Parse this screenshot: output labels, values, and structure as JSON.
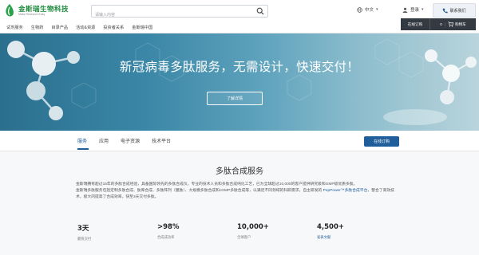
{
  "header": {
    "logo_title": "金斯瑞生物科技",
    "logo_subtitle": "Make Research Easy",
    "search_placeholder": "请输入内容",
    "language": "中文",
    "login": "登录",
    "contact": "联系我们"
  },
  "nav": {
    "items": [
      "试剂服务",
      "生物药",
      "目录产品",
      "活动&资源",
      "投资者关系",
      "金斯瑞中国"
    ],
    "order_online": "在线订购",
    "cart_label": "购物车",
    "cart_count": "0"
  },
  "hero": {
    "title": "新冠病毒多肽服务，无需设计，快速交付！",
    "button": "了解详情"
  },
  "subnav": {
    "tabs": [
      "服务",
      "应用",
      "电子资源",
      "技术平台"
    ],
    "active_tab": "服务",
    "order_button": "在线订购"
  },
  "content": {
    "section_title": "多肽合成服务",
    "para1": "金斯瑞拥有超过15年的多肽合成经验，具备国际领先的多肽合成仪，专业的技术人员和多肽合成纯化工艺，已为全球超过10,000的客户提供研究级和GMP级优质多肽。",
    "para2_a": "金斯瑞多肽服务包括定制多肽合成、肽库合成、多肽阵列（膜肽）、大规模多肽合成和cGMP多肽合成等，以满足不同领域的科研需求。自主研发的 ",
    "para2_highlight": "PepPower™多肽合成平台",
    "para2_b": "，整合了高效技术，极大的提高了合成效率，快至3天交付多肽。",
    "stats": [
      {
        "value": "3天",
        "label": "最快交付",
        "link": false
      },
      {
        "value": ">98%",
        "label": "合成成功率",
        "link": false
      },
      {
        "value": "10,000+",
        "label": "全球客户",
        "link": false
      },
      {
        "value": "4,500+",
        "label": "发表文献",
        "link": true
      }
    ]
  },
  "colors": {
    "brand_green": "#1a8a3a",
    "primary_blue": "#1f5e9a",
    "dark_nav": "#333a42"
  }
}
